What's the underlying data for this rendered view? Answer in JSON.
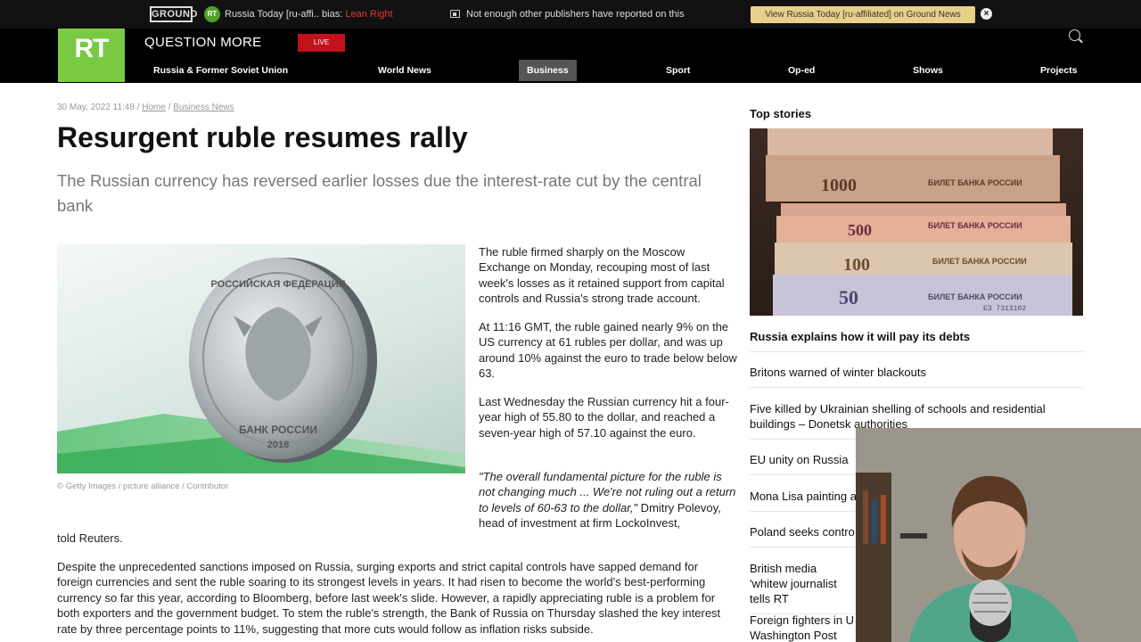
{
  "ground_news": {
    "logo": "GROUND",
    "source_icon": "RT",
    "source_name": "Russia Today [ru-affi.. bias:",
    "bias": "Lean Right",
    "message": "Not enough other publishers have reported on this",
    "view_button": "View Russia Today [ru-affiliated] on Ground News",
    "close": "×"
  },
  "header": {
    "logo": "RT",
    "slogan": "QUESTION MORE",
    "live": "LIVE",
    "nav": [
      "Russia & Former Soviet Union",
      "World News",
      "Business",
      "Sport",
      "Op-ed",
      "Shows",
      "Projects"
    ],
    "active_nav": "Business"
  },
  "article": {
    "date": "30 May, 2022 11:48",
    "breadcrumb": [
      "Home",
      "Business News"
    ],
    "separator": "/",
    "title": "Resurgent ruble resumes rally",
    "subtitle": "The Russian currency has reversed earlier losses due the interest-rate cut by the central bank",
    "image_caption": "© Getty Images / picture alliance / Contributor",
    "coin_text_top": "РОССИЙСКАЯ ФЕДЕРАЦИЯ",
    "coin_text_bottom": "БАНК РОССИИ",
    "coin_year": "2018",
    "p1": "The ruble firmed sharply on the Moscow Exchange on Monday, recouping most of last week's losses as it retained support from capital controls and Russia's strong trade account.",
    "p2": "At 11:16 GMT, the ruble gained nearly 9% on the US currency at 61 rubles per dollar, and was up around 10% against the euro to trade below below 63.",
    "p3": "Last Wednesday the Russian currency hit a four-year high of 55.80 to the dollar, and reached a seven-year high of 57.10 against the euro.",
    "p4_quote": "\"The overall fundamental picture for the ruble is not changing much ... We're not ruling out a return to levels of 60-63 to the dollar,\"",
    "p4_attribution": " Dmitry Polevoy, head of investment at firm LockoInvest,",
    "p4_end": "told Reuters.",
    "p5": "Despite the unprecedented sanctions imposed on Russia, surging exports and strict capital controls have sapped demand for foreign currencies and sent the ruble soaring to its strongest levels in years. It had risen to become the world's best-performing currency so far this year, according to Bloomberg, before last week's slide. However, a rapidly appreciating ruble is a problem for both exporters and the government budget. To stem the ruble's strength, the Bank of Russia on Thursday slashed the key interest rate by three percentage points to 11%, suggesting that more cuts would follow as inflation risks subside."
  },
  "sidebar": {
    "heading": "Top stories",
    "banknotes": [
      "1000",
      "500",
      "100",
      "50"
    ],
    "bank_label": "БИЛЕТ БАНКА РОССИИ",
    "serial": "ЕЗ 7313102",
    "stories": [
      "Russia explains how it will pay its debts",
      "Britons warned of winter blackouts",
      "Five killed by Ukrainian shelling of schools and residential buildings – Donetsk authorities",
      "EU unity on Russia",
      "Mona Lisa painting a",
      "Poland seeks contro",
      "British media 'whitew journalist tells RT",
      "Foreign fighters in U Washington Post"
    ]
  },
  "colors": {
    "rt_green": "#79c943",
    "live_red": "#c1121c",
    "bias_red": "#e23b3b",
    "gn_button": "#e9d08a"
  }
}
